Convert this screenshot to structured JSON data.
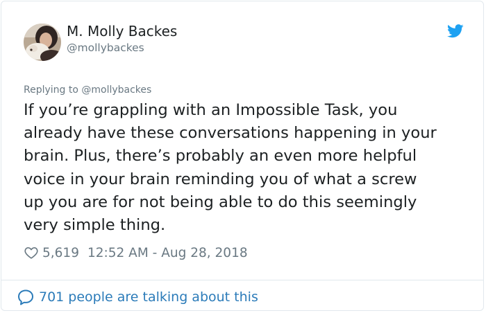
{
  "author": {
    "name": "M. Molly Backes",
    "handle": "@mollybackes",
    "avatar_icon": "profile-photo"
  },
  "brand": {
    "icon": "twitter-bird-icon",
    "color": "#1da1f2"
  },
  "tweet": {
    "replying_to": "Replying to @mollybackes",
    "text": "If you’re grappling with an Impossible Task, you\nalready have these conversations happening in your\nbrain. Plus, there’s probably an even more helpful\nvoice in your brain reminding you of what a screw\nup you are for not being able to do this seemingly\nvery simple thing.",
    "likes": "5,619",
    "timestamp": "12:52 AM - Aug 28, 2018"
  },
  "footer": {
    "talking": "701 people are talking about this",
    "icon": "speech-bubble-icon",
    "link_color": "#2b7bb9"
  }
}
